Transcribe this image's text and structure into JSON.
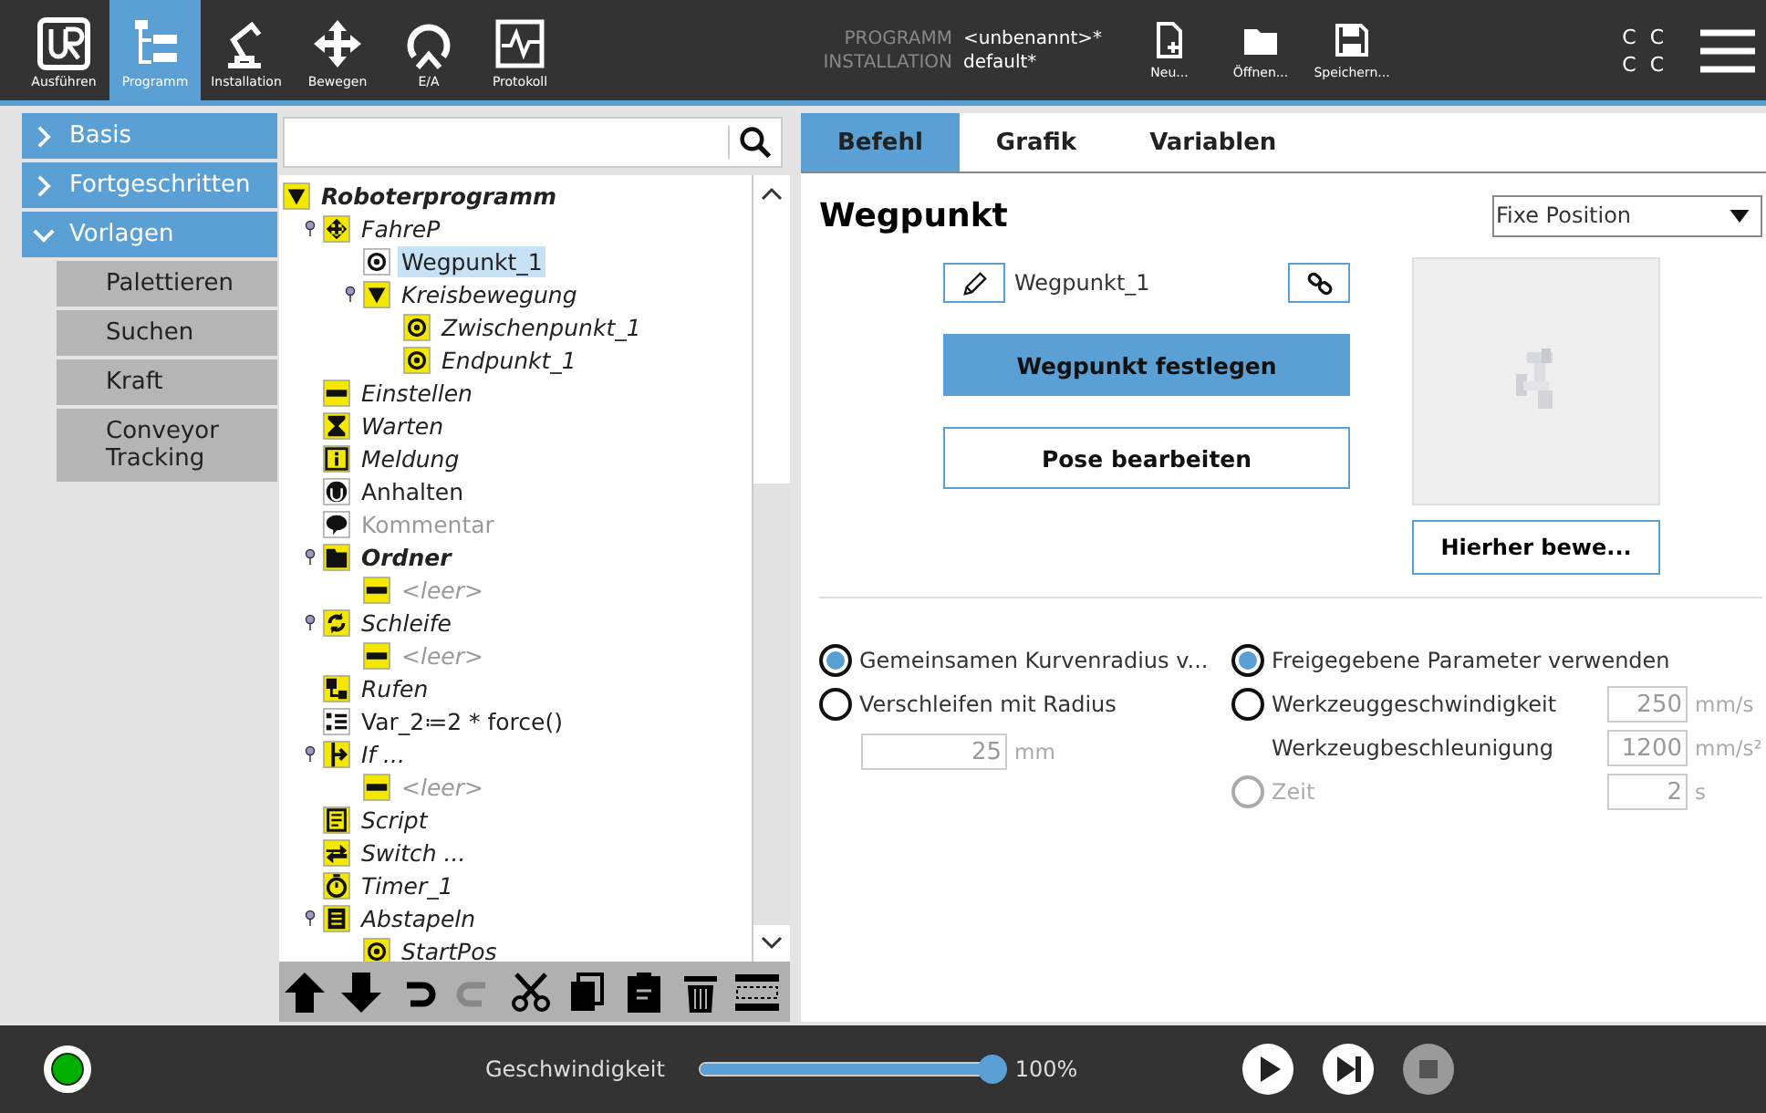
{
  "top_bar": {
    "nav_tabs": [
      {
        "label": "Ausführen",
        "kind": "logo",
        "selected": false
      },
      {
        "label": "Programm",
        "kind": "program",
        "selected": true
      },
      {
        "label": "Installation",
        "kind": "arm",
        "selected": false
      },
      {
        "label": "Bewegen",
        "kind": "move",
        "selected": false
      },
      {
        "label": "E/A",
        "kind": "io",
        "selected": false
      },
      {
        "label": "Protokoll",
        "kind": "log",
        "selected": false
      }
    ],
    "program_label": "PROGRAMM",
    "program_value": "<unbenannt>*",
    "installation_label": "INSTALLATION",
    "installation_value": "default*",
    "file_buttons": [
      {
        "label": "Neu...",
        "kind": "new"
      },
      {
        "label": "Öffnen...",
        "kind": "open"
      },
      {
        "label": "Speichern...",
        "kind": "save"
      }
    ],
    "status_letters": [
      "C C",
      "C C"
    ]
  },
  "sidebar": {
    "categories": [
      {
        "label": "Basis",
        "expanded": false
      },
      {
        "label": "Fortgeschritten",
        "expanded": false
      },
      {
        "label": "Vorlagen",
        "expanded": true
      }
    ],
    "items": [
      "Palettieren",
      "Suchen",
      "Kraft",
      "Conveyor Tracking"
    ]
  },
  "program_tree": {
    "label": "Roboterprogramm",
    "kind": "folder-arrow",
    "bold": true,
    "italic": true,
    "disabled": false,
    "selected": false,
    "children": [
      {
        "label": "FahreP",
        "kind": "move",
        "bold": false,
        "italic": true,
        "disabled": false,
        "selected": false,
        "children": [
          {
            "label": "Wegpunkt_1",
            "kind": "waypoint",
            "bold": false,
            "italic": false,
            "disabled": false,
            "selected": true
          },
          {
            "label": "Kreisbewegung",
            "kind": "folder-arrow",
            "bold": false,
            "italic": true,
            "disabled": false,
            "selected": false,
            "children": [
              {
                "label": "Zwischenpunkt_1",
                "kind": "waypoint",
                "bold": false,
                "italic": true,
                "disabled": false,
                "selected": false
              },
              {
                "label": "Endpunkt_1",
                "kind": "waypoint",
                "bold": false,
                "italic": true,
                "disabled": false,
                "selected": false
              }
            ]
          }
        ]
      },
      {
        "label": "Einstellen",
        "kind": "set",
        "bold": false,
        "italic": true,
        "disabled": false,
        "selected": false
      },
      {
        "label": "Warten",
        "kind": "wait",
        "bold": false,
        "italic": true,
        "disabled": false,
        "selected": false
      },
      {
        "label": "Meldung",
        "kind": "popup",
        "bold": false,
        "italic": true,
        "disabled": false,
        "selected": false
      },
      {
        "label": "Anhalten",
        "kind": "halt",
        "bold": false,
        "italic": false,
        "disabled": false,
        "selected": false
      },
      {
        "label": "Kommentar",
        "kind": "comment",
        "bold": false,
        "italic": false,
        "disabled": true,
        "selected": false
      },
      {
        "label": "Ordner",
        "kind": "folder",
        "bold": true,
        "italic": true,
        "disabled": false,
        "selected": false,
        "children": [
          {
            "label": "<leer>",
            "kind": "set",
            "bold": false,
            "italic": true,
            "disabled": true,
            "selected": false
          }
        ]
      },
      {
        "label": "Schleife",
        "kind": "loop",
        "bold": false,
        "italic": true,
        "disabled": false,
        "selected": false,
        "children": [
          {
            "label": "<leer>",
            "kind": "set",
            "bold": false,
            "italic": true,
            "disabled": true,
            "selected": false
          }
        ]
      },
      {
        "label": "Rufen",
        "kind": "call",
        "bold": false,
        "italic": true,
        "disabled": false,
        "selected": false
      },
      {
        "label": "Var_2≔2 * force()",
        "kind": "assign",
        "bold": false,
        "italic": false,
        "disabled": false,
        "selected": false
      },
      {
        "label": "If ...",
        "kind": "if",
        "bold": false,
        "italic": true,
        "disabled": false,
        "selected": false,
        "children": [
          {
            "label": "<leer>",
            "kind": "set",
            "bold": false,
            "italic": true,
            "disabled": true,
            "selected": false
          }
        ]
      },
      {
        "label": "Script",
        "kind": "script",
        "bold": false,
        "italic": true,
        "disabled": false,
        "selected": false
      },
      {
        "label": "Switch ...",
        "kind": "switch",
        "bold": false,
        "italic": true,
        "disabled": false,
        "selected": false
      },
      {
        "label": "Timer_1",
        "kind": "timer",
        "bold": false,
        "italic": true,
        "disabled": false,
        "selected": false
      },
      {
        "label": "Abstapeln",
        "kind": "pallet",
        "bold": false,
        "italic": true,
        "disabled": false,
        "selected": false,
        "children": [
          {
            "label": "StartPos",
            "kind": "waypoint",
            "bold": false,
            "italic": true,
            "disabled": false,
            "selected": false
          }
        ]
      }
    ]
  },
  "tree_toolbar": [
    {
      "kind": "up",
      "disabled": false
    },
    {
      "kind": "down",
      "disabled": false
    },
    {
      "kind": "undo",
      "disabled": false
    },
    {
      "kind": "redo",
      "disabled": true
    },
    {
      "kind": "cut",
      "disabled": false
    },
    {
      "kind": "copy",
      "disabled": false
    },
    {
      "kind": "paste",
      "disabled": false
    },
    {
      "kind": "delete",
      "disabled": false
    },
    {
      "kind": "suppress",
      "disabled": false
    }
  ],
  "editor": {
    "tabs": [
      {
        "label": "Befehl",
        "selected": true
      },
      {
        "label": "Grafik",
        "selected": false
      },
      {
        "label": "Variablen",
        "selected": false
      }
    ],
    "title": "Wegpunkt",
    "position_type": "Fixe Position",
    "waypoint_name": "Wegpunkt_1",
    "set_button": "Wegpunkt festlegen",
    "edit_pose_button": "Pose bearbeiten",
    "move_here_button": "Hierher bewe...",
    "blend_options": [
      {
        "label": "Gemeinsamen Kurvenradius v...",
        "selected": true
      },
      {
        "label": "Verschleifen mit Radius",
        "selected": false
      }
    ],
    "blend_radius": {
      "value": "25",
      "unit": "mm"
    },
    "speed_options": [
      {
        "label": "Freigegebene Parameter verwenden",
        "kind": "radio",
        "selected": true,
        "disabled": false
      },
      {
        "label": "Werkzeuggeschwindigkeit",
        "kind": "radio-field",
        "selected": false,
        "disabled": false,
        "value": "250",
        "unit": "mm/s"
      },
      {
        "label": "Werkzeugbeschleunigung",
        "kind": "field",
        "value": "1200",
        "unit": "mm/s²"
      },
      {
        "label": "Zeit",
        "kind": "radio-field",
        "selected": false,
        "disabled": true,
        "value": "2",
        "unit": "s"
      }
    ]
  },
  "bottom_bar": {
    "speed_label": "Geschwindigkeit",
    "speed": {
      "level": 0.99
    },
    "speed_reading": "100%",
    "stop_disabled": true
  }
}
